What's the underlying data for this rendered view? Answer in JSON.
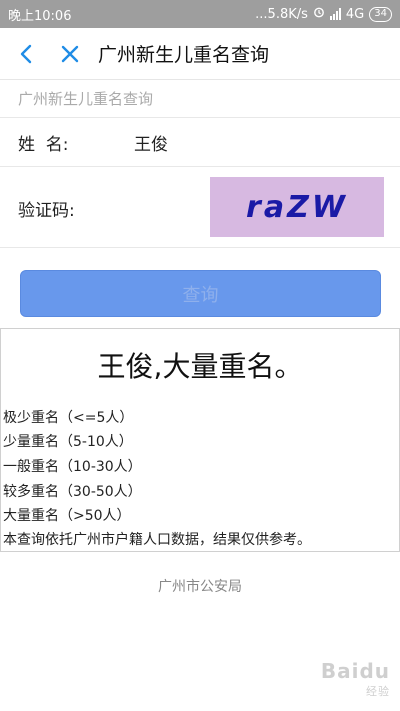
{
  "status_bar": {
    "time": "晚上10:06",
    "speed": "...5.8K/s",
    "network": "4G",
    "battery": "34"
  },
  "nav": {
    "title": "广州新生儿重名查询"
  },
  "form": {
    "heading": "广州新生儿重名查询",
    "name_label": "姓  名:",
    "name_value": "王俊",
    "captcha_label": "验证码:",
    "captcha_text": "raZW",
    "query_button": "查询"
  },
  "result": {
    "title": "王俊,大量重名。",
    "lines": [
      "极少重名（<=5人）",
      "少量重名（5-10人）",
      "一般重名（10-30人）",
      "较多重名（30-50人）",
      "大量重名（>50人）",
      "本查询依托广州市户籍人口数据，结果仅供参考。"
    ]
  },
  "footer": {
    "text": "广州市公安局"
  },
  "watermark": {
    "brand": "Baidu",
    "sub": "经验"
  },
  "colors": {
    "accent": "#1f8ce6",
    "button": "#6898ec",
    "captcha_bg": "#d7b9e1",
    "captcha_text": "#1a1aa6"
  }
}
